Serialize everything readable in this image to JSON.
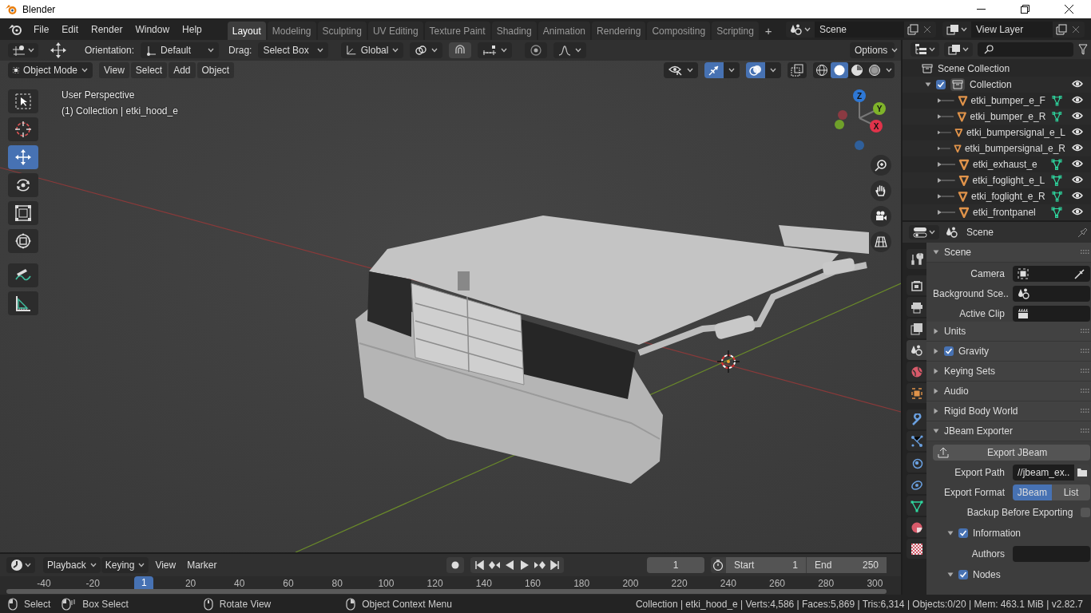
{
  "window": {
    "title": "Blender"
  },
  "menu": [
    "File",
    "Edit",
    "Render",
    "Window",
    "Help"
  ],
  "workspaces": [
    {
      "label": "Layout",
      "selected": true
    },
    {
      "label": "Modeling",
      "selected": false
    },
    {
      "label": "Sculpting",
      "selected": false
    },
    {
      "label": "UV Editing",
      "selected": false
    },
    {
      "label": "Texture Paint",
      "selected": false
    },
    {
      "label": "Shading",
      "selected": false
    },
    {
      "label": "Animation",
      "selected": false
    },
    {
      "label": "Rendering",
      "selected": false
    },
    {
      "label": "Compositing",
      "selected": false
    },
    {
      "label": "Scripting",
      "selected": false
    }
  ],
  "add_workspace": "+",
  "scene": {
    "value": "Scene"
  },
  "view_layer": {
    "value": "View Layer"
  },
  "tool_settings": {
    "orientation_label": "Orientation:",
    "orientation": "Default",
    "drag_label": "Drag:",
    "drag": "Select Box",
    "transform_orientation": "Global",
    "options": "Options"
  },
  "viewport_header": {
    "mode": "Object Mode",
    "menus": [
      "View",
      "Select",
      "Add",
      "Object"
    ],
    "gizmos_on": true,
    "overlays_on": true,
    "xray_on": false,
    "shading": [
      {
        "kind": "wireframe",
        "selected": false
      },
      {
        "kind": "solid",
        "selected": true
      },
      {
        "kind": "material",
        "selected": false
      },
      {
        "kind": "rendered",
        "selected": false
      }
    ]
  },
  "toolbar": [
    {
      "kind": "select",
      "selected": false
    },
    {
      "kind": "cursor",
      "selected": false
    },
    {
      "kind": "move",
      "selected": true
    },
    {
      "kind": "rotate",
      "selected": false
    },
    {
      "kind": "scale",
      "selected": false
    },
    {
      "kind": "transform",
      "selected": false
    },
    {
      "kind": "annotate",
      "selected": false
    },
    {
      "kind": "measure",
      "selected": false
    }
  ],
  "viewport": {
    "view_name": "User Perspective",
    "object_info": "(1) Collection | etki_hood_e"
  },
  "gizmo": {
    "x": "X",
    "y": "Y",
    "z": "Z"
  },
  "outliner": {
    "root": "Scene Collection",
    "items": [
      {
        "label": "Collection",
        "checked": true,
        "expanded": true,
        "visible": true,
        "children": [
          {
            "label": "etki_bumper_e_F",
            "mesh_data": true,
            "visible": true
          },
          {
            "label": "etki_bumper_e_R",
            "mesh_data": true,
            "visible": true
          },
          {
            "label": "etki_bumpersignal_e_L",
            "mesh_data": false,
            "visible": true
          },
          {
            "label": "etki_bumpersignal_e_R",
            "mesh_data": false,
            "visible": true
          },
          {
            "label": "etki_exhaust_e",
            "mesh_data": true,
            "visible": true
          },
          {
            "label": "etki_foglight_e_L",
            "mesh_data": true,
            "visible": true
          },
          {
            "label": "etki_foglight_e_R",
            "mesh_data": true,
            "visible": true
          },
          {
            "label": "etki_frontpanel",
            "mesh_data": true,
            "visible": true
          }
        ]
      }
    ]
  },
  "properties": {
    "context": "Scene",
    "tabs": [
      {
        "kind": "tool",
        "selected": false
      },
      {
        "kind": "render",
        "selected": false
      },
      {
        "kind": "output",
        "selected": false
      },
      {
        "kind": "view_layer",
        "selected": false
      },
      {
        "kind": "scene",
        "selected": true
      },
      {
        "kind": "world",
        "selected": false
      },
      {
        "kind": "object",
        "selected": false
      },
      {
        "kind": "modifiers",
        "selected": false
      },
      {
        "kind": "particles",
        "selected": false
      },
      {
        "kind": "physics",
        "selected": false
      },
      {
        "kind": "constraints",
        "selected": false
      },
      {
        "kind": "data",
        "selected": false
      },
      {
        "kind": "material",
        "selected": false
      },
      {
        "kind": "texture",
        "selected": false
      }
    ],
    "panels": [
      {
        "label": "Scene",
        "expanded": true,
        "rows": [
          {
            "kind": "object_field",
            "label": "Camera"
          },
          {
            "kind": "scene_field",
            "label": "Background Sce.."
          },
          {
            "kind": "clip_field",
            "label": "Active Clip"
          }
        ]
      },
      {
        "label": "Units",
        "expanded": false
      },
      {
        "label": "Gravity",
        "expanded": false,
        "checked": true
      },
      {
        "label": "Keying Sets",
        "expanded": false
      },
      {
        "label": "Audio",
        "expanded": false
      },
      {
        "label": "Rigid Body World",
        "expanded": false
      },
      {
        "label": "JBeam Exporter",
        "expanded": true,
        "rows": [
          {
            "kind": "button",
            "label": "Export JBeam"
          },
          {
            "kind": "path",
            "label": "Export Path",
            "value": "//jbeam_ex.."
          },
          {
            "kind": "segmented",
            "label": "Export Format",
            "options": [
              {
                "label": "JBeam",
                "selected": true
              },
              {
                "label": "List",
                "selected": false
              }
            ]
          },
          {
            "kind": "checkbox",
            "label": "Backup Before Exporting",
            "checked": false
          },
          {
            "kind": "subpanel",
            "label": "Information",
            "checked": true,
            "expanded": true
          },
          {
            "kind": "text",
            "label": "Authors"
          },
          {
            "kind": "subpanel",
            "label": "Nodes",
            "checked": true,
            "expanded": true
          }
        ]
      }
    ]
  },
  "timeline": {
    "menus": [
      "Playback",
      "Keying"
    ],
    "plain_menus": [
      "View",
      "Marker"
    ],
    "current_frame": "1",
    "start_label": "Start",
    "start": "1",
    "end_label": "End",
    "end": "250",
    "playhead": "1",
    "ruler": [
      "-40",
      "-20",
      "20",
      "40",
      "60",
      "80",
      "100",
      "120",
      "140",
      "160",
      "180",
      "200",
      "220",
      "240",
      "260",
      "280",
      "300"
    ]
  },
  "status_bar": {
    "hints": [
      {
        "kind": "left",
        "label": "Select"
      },
      {
        "kind": "drag",
        "label": "Box Select"
      },
      {
        "kind": "middle",
        "label": "Rotate View"
      },
      {
        "kind": "right",
        "label": "Object Context Menu"
      }
    ],
    "stats": "Collection | etki_hood_e | Verts:4,586 | Faces:5,869 | Tris:6,314 | Objects:0/20 | Mem: 463.1 MiB | v2.82.7"
  }
}
